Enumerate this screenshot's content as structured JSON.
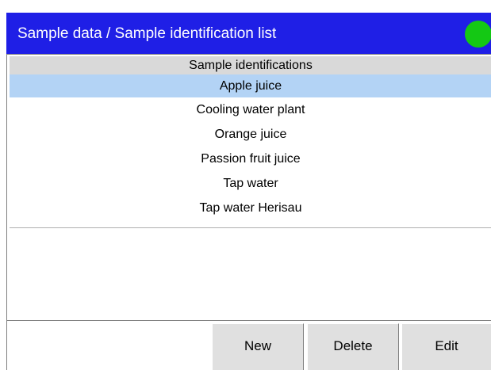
{
  "titlebar": {
    "title": "Sample data / Sample identification list",
    "status_color": "#14c814"
  },
  "list": {
    "header": "Sample identifications",
    "selected_index": 0,
    "items": [
      "Apple juice",
      "Cooling water plant",
      "Orange juice",
      "Passion fruit juice",
      "Tap water",
      "Tap water Herisau"
    ]
  },
  "toolbar": {
    "new_label": "New",
    "delete_label": "Delete",
    "edit_label": "Edit"
  },
  "colors": {
    "title_bar": "#1f1fe6",
    "selection": "#b3d3f5",
    "header": "#d9d9d9",
    "button": "#e0e0e0"
  }
}
